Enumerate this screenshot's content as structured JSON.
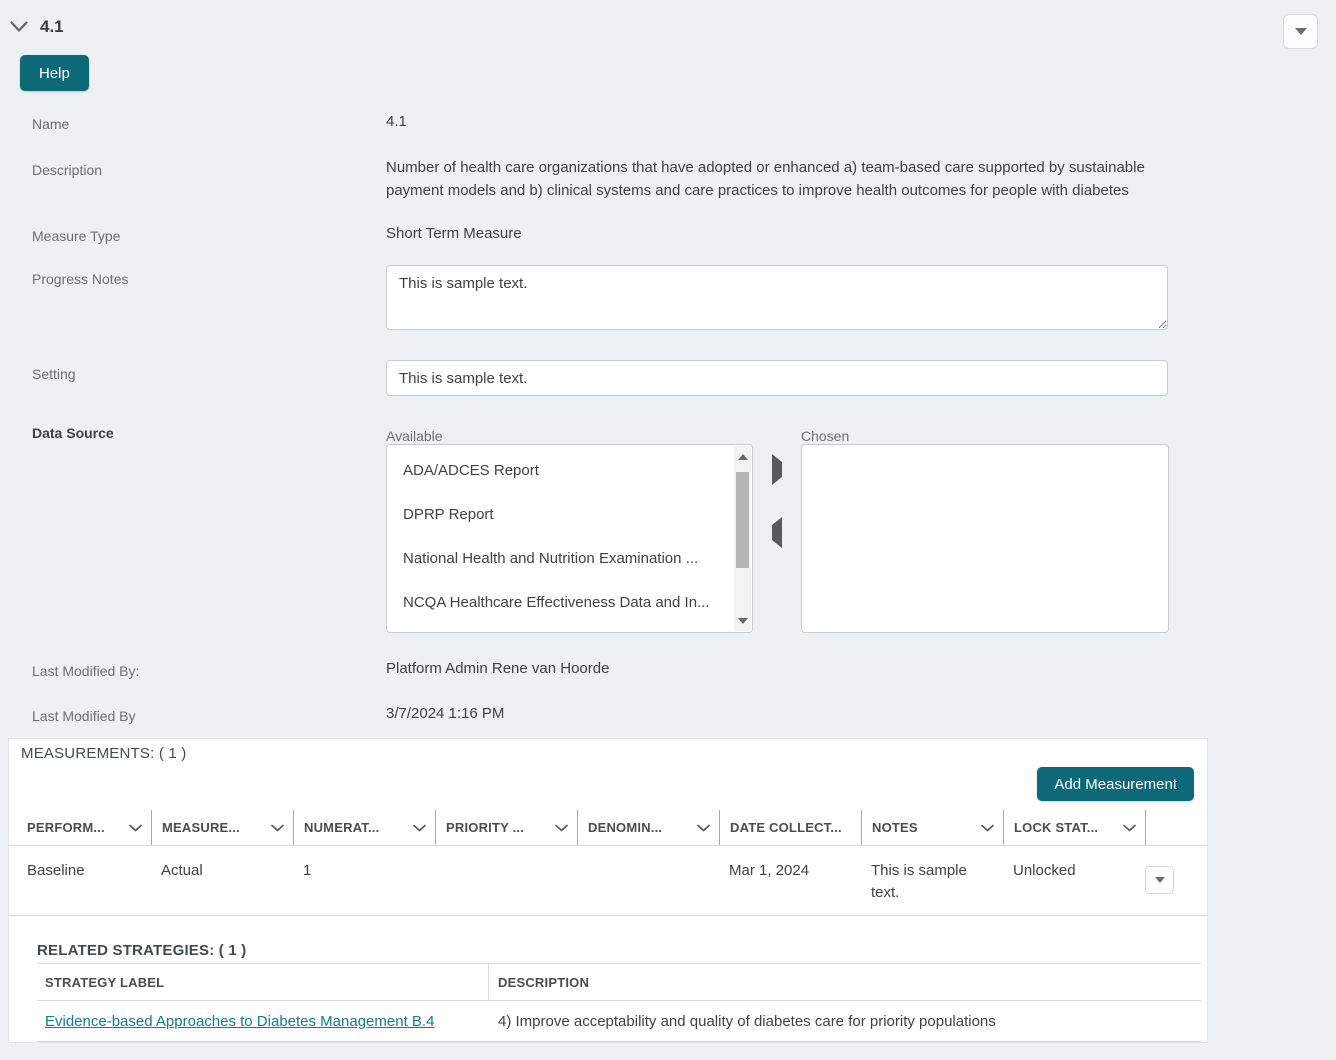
{
  "header": {
    "title": "4.1",
    "help_label": "Help"
  },
  "fields": {
    "name": {
      "label": "Name",
      "value": "4.1"
    },
    "description": {
      "label": "Description",
      "value": "Number of health care organizations that have adopted or enhanced a) team-based care supported by sustainable payment models and b) clinical systems and care practices to improve health outcomes for people with diabetes"
    },
    "measure_type": {
      "label": "Measure Type",
      "value": "Short Term Measure"
    },
    "progress_notes": {
      "label": "Progress Notes",
      "value": "This is sample text."
    },
    "setting": {
      "label": "Setting",
      "value": "This is sample text."
    },
    "data_source": {
      "label": "Data Source",
      "available_label": "Available",
      "chosen_label": "Chosen",
      "available_options": [
        "ADA/ADCES Report",
        "DPRP Report",
        "National Health and Nutrition Examination ...",
        "NCQA Healthcare Effectiveness Data and In..."
      ],
      "chosen_options": []
    },
    "last_modified_by": {
      "label": "Last Modified By:",
      "value": "Platform Admin Rene van Hoorde"
    },
    "last_modified_date": {
      "label": "Last Modified By",
      "value": "3/7/2024 1:16 PM"
    }
  },
  "measurements": {
    "heading": "MEASUREMENTS: ( 1 )",
    "add_button_label": "Add Measurement",
    "columns": [
      "PERFORM...",
      "MEASURE...",
      "NUMERAT...",
      "PRIORITY ...",
      "DENOMIN...",
      "DATE COLLECT...",
      "NOTES",
      "LOCK STAT...",
      ""
    ],
    "rows": [
      {
        "performance": "Baseline",
        "measure": "Actual",
        "numerator": "1",
        "priority": "",
        "denominator": "",
        "date_collected": "Mar 1, 2024",
        "notes": "This is sample text.",
        "lock_status": "Unlocked"
      }
    ]
  },
  "related_strategies": {
    "heading": "RELATED STRATEGIES: ( 1 )",
    "columns": [
      "STRATEGY LABEL",
      "DESCRIPTION"
    ],
    "rows": [
      {
        "strategy_label": "Evidence-based Approaches to Diabetes Management B.4",
        "description": "4) Improve acceptability and quality of diabetes care for priority populations"
      }
    ]
  },
  "colors": {
    "accent_teal": "#0d6978",
    "link_teal": "#147a90",
    "page_bg": "#edf1f4"
  }
}
